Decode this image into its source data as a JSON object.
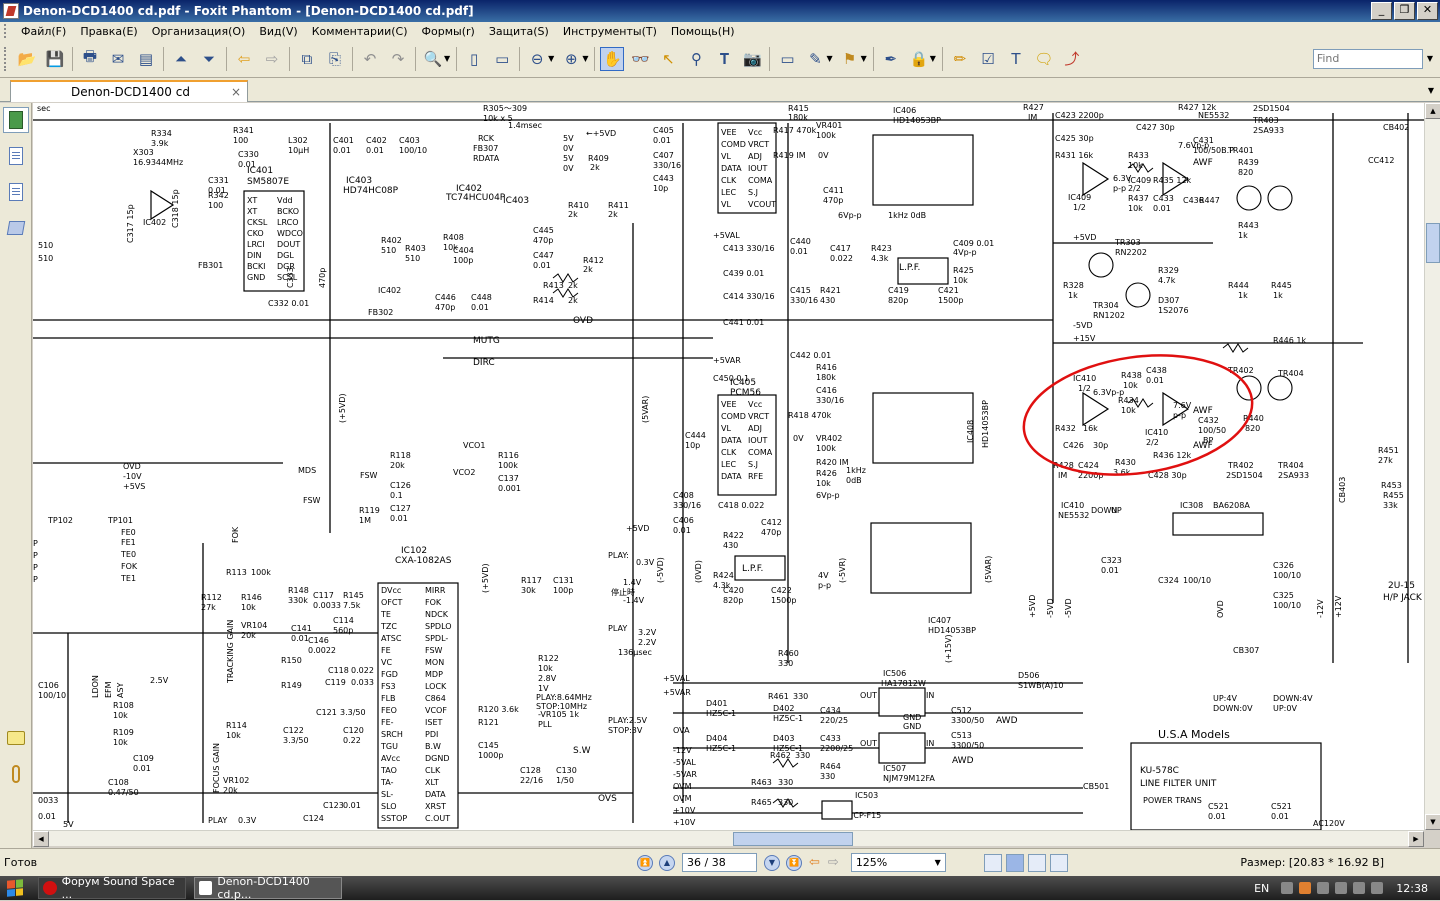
{
  "window": {
    "title": "Denon-DCD1400 cd.pdf - Foxit Phantom - [Denon-DCD1400 cd.pdf]",
    "minimize_label": "_",
    "restore_label": "❐",
    "close_label": "✕"
  },
  "menu": {
    "items": [
      "Файл(F)",
      "Правка(E)",
      "Организация(O)",
      "Вид(V)",
      "Комментарии(C)",
      "Формы(r)",
      "Защита(S)",
      "Инструменты(T)",
      "Помощь(H)"
    ]
  },
  "toolbar": {
    "find_placeholder": "Find"
  },
  "tabs": {
    "doc_label": "Denon-DCD1400 cd",
    "close_glyph": "×"
  },
  "status": {
    "left_text": "Готов",
    "page_value": "36 / 38",
    "zoom_value": "125%",
    "size_text": "Размер: [20.83 * 16.92 В]"
  },
  "taskbar": {
    "tasks": [
      {
        "label": "Форум Sound Space ..."
      },
      {
        "label": "Denon-DCD1400 cd.p..."
      }
    ],
    "lang": "EN",
    "clock": "12:38"
  },
  "schematic": {
    "labels": {
      "ic401": "IC401",
      "ic401_part": "SM5807E",
      "ic403": "IC403",
      "ic403_part": "HD74HC08P",
      "ic402": "IC402",
      "ic402_part": "TC74HCU04P",
      "ic405": "IC405",
      "ic405_part": "PCM56",
      "ic406": "IC406",
      "ic406_part": "HD14053BP",
      "ic407": "IC407",
      "ic407_part": "HD14053BP",
      "ic408": "IC408",
      "ic408_part": "HD14053BP",
      "ic409": "IC409",
      "ic410": "IC410",
      "ic410_part": "NE5532",
      "ic102": "IC102",
      "ic102_part": "CXA-1082AS",
      "ic308": "IC308",
      "ic308_part": "BA6208A",
      "ic506": "IC506",
      "ic506_part": "HA17812W",
      "ic507": "IC507",
      "ic507_part": "NJM79M12FA",
      "ic503": "IC503",
      "ic503_part": "ICP-F15",
      "ne5532": "NE5532",
      "sd2504": "2SD1504",
      "sa933": "2SA933",
      "tr401": "TR401",
      "tr402": "TR402",
      "tr403": "TR403",
      "tr404": "TR404",
      "tr303": "TR303",
      "tr303_part": "RN2202",
      "tr304": "TR304",
      "tr304_part": "RN1202",
      "d307": "D307",
      "d307_part": "1S2076",
      "lpf": "L.P.F.",
      "awf": "AWF",
      "usa_models": "U.S.A Models",
      "ku578c": "KU-578C",
      "line_filter": "LINE FILTER UNIT",
      "power_trans": "POWER TRANS",
      "hp_jack": "H/P JACK",
      "u15": "2U-15",
      "cb402": "CB402",
      "cb403": "CB403",
      "cb307": "CB307",
      "cb501": "CB501",
      "ovd": "OVD",
      "mutg": "MUTG",
      "dirc": "DIRC",
      "mds": "MDS",
      "fsw": "FSW",
      "p5vd": "+5VD",
      "p5val": "+5VAL",
      "p5var": "+5VAR",
      "p15v": "+15V",
      "m10v": "-10V",
      "p5vs": "+5VS",
      "vco1": "VCO1",
      "vco2": "VCO2",
      "ovs": "OVS",
      "ovm": "OVM",
      "p10v": "+10V",
      "m12v": "-12V",
      "m5var": "-5VAR",
      "ova": "OVA",
      "tp102": "TP102",
      "tp101": "TP101",
      "x303": "X303",
      "x303_freq": "16.9344MHz",
      "tracking_gain": "TRACKING GAIN",
      "focus_gain": "FOCUS GAIN",
      "play": "PLAY",
      "play_val": "0.3V",
      "sw": "S.W",
      "asy": "ASY",
      "up": "UP",
      "down": "DOWN"
    }
  }
}
